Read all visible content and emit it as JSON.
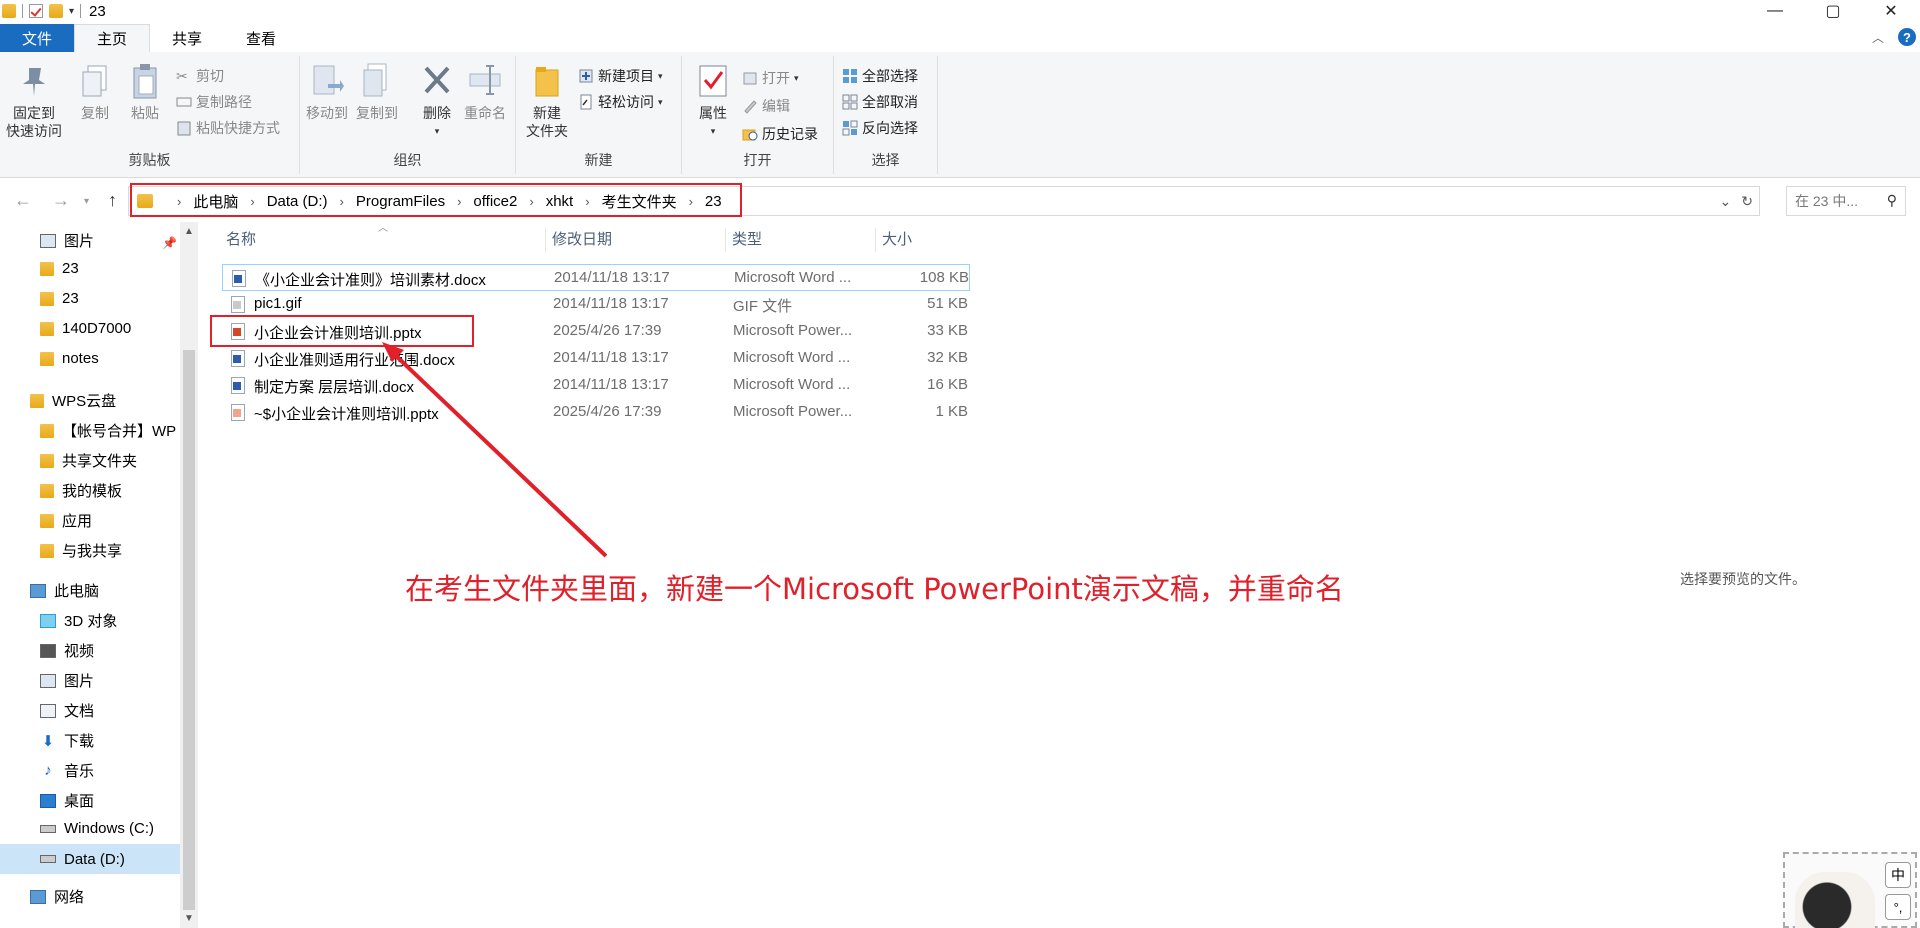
{
  "window": {
    "title": "23",
    "controls": [
      "—",
      "▢",
      "✕"
    ]
  },
  "tabs": [
    {
      "label": "文件"
    },
    {
      "label": "主页"
    },
    {
      "label": "共享"
    },
    {
      "label": "查看"
    }
  ],
  "ribbon": {
    "clipboard": {
      "label": "剪贴板",
      "pin": "固定到\n快速访问",
      "pin_line1": "固定到",
      "pin_line2": "快速访问",
      "copy": "复制",
      "paste": "粘贴",
      "cut": "剪切",
      "copy_path": "复制路径",
      "paste_shortcut": "粘贴快捷方式"
    },
    "organize": {
      "label": "组织",
      "move_to": "移动到",
      "copy_to": "复制到",
      "delete": "删除",
      "rename": "重命名"
    },
    "new": {
      "label": "新建",
      "new_folder_line1": "新建",
      "new_folder_line2": "文件夹",
      "new_item": "新建项目",
      "easy_access": "轻松访问"
    },
    "open": {
      "label": "打开",
      "properties": "属性",
      "open": "打开",
      "edit": "编辑",
      "history": "历史记录"
    },
    "select": {
      "label": "选择",
      "select_all": "全部选择",
      "select_none": "全部取消",
      "invert": "反向选择"
    }
  },
  "address": {
    "crumbs": [
      "此电脑",
      "Data (D:)",
      "ProgramFiles",
      "office2",
      "xhkt",
      "考生文件夹",
      "23"
    ],
    "search_placeholder": "在 23 中..."
  },
  "sidebar": {
    "items": [
      {
        "label": "图片",
        "type": "pictures"
      },
      {
        "label": "23",
        "type": "folder"
      },
      {
        "label": "23",
        "type": "folder"
      },
      {
        "label": "140D7000",
        "type": "folder"
      },
      {
        "label": "notes",
        "type": "folder"
      },
      {
        "label": "WPS云盘",
        "type": "cloud"
      },
      {
        "label": "【帐号合并】WP",
        "type": "folder"
      },
      {
        "label": "共享文件夹",
        "type": "shared"
      },
      {
        "label": "我的模板",
        "type": "folder"
      },
      {
        "label": "应用",
        "type": "folder"
      },
      {
        "label": "与我共享",
        "type": "folder"
      },
      {
        "label": "此电脑",
        "type": "pc"
      },
      {
        "label": "3D 对象",
        "type": "3d"
      },
      {
        "label": "视频",
        "type": "video"
      },
      {
        "label": "图片",
        "type": "pictures"
      },
      {
        "label": "文档",
        "type": "docs"
      },
      {
        "label": "下载",
        "type": "download"
      },
      {
        "label": "音乐",
        "type": "music"
      },
      {
        "label": "桌面",
        "type": "desktop"
      },
      {
        "label": "Windows (C:)",
        "type": "drive"
      },
      {
        "label": "Data (D:)",
        "type": "drive"
      },
      {
        "label": "网络",
        "type": "network"
      }
    ]
  },
  "file_list": {
    "headers": {
      "name": "名称",
      "date": "修改日期",
      "type": "类型",
      "size": "大小"
    },
    "rows": [
      {
        "name": "《小企业会计准则》培训素材.docx",
        "date": "2014/11/18 13:17",
        "type": "Microsoft Word ...",
        "size": "108 KB",
        "icon": "word"
      },
      {
        "name": "pic1.gif",
        "date": "2014/11/18 13:17",
        "type": "GIF 文件",
        "size": "51 KB",
        "icon": "gif"
      },
      {
        "name": "小企业会计准则培训.pptx",
        "date": "2025/4/26 17:39",
        "type": "Microsoft Power...",
        "size": "33 KB",
        "icon": "ppt"
      },
      {
        "name": "小企业准则适用行业范围.docx",
        "date": "2014/11/18 13:17",
        "type": "Microsoft Word ...",
        "size": "32 KB",
        "icon": "word"
      },
      {
        "name": "制定方案 层层培训.docx",
        "date": "2014/11/18 13:17",
        "type": "Microsoft Word ...",
        "size": "16 KB",
        "icon": "word"
      },
      {
        "name": "~$小企业会计准则培训.pptx",
        "date": "2025/4/26 17:39",
        "type": "Microsoft Power...",
        "size": "1 KB",
        "icon": "pptfaint"
      }
    ]
  },
  "annotation": "在考生文件夹里面，新建一个Microsoft PowerPoint演示文稿，并重命名",
  "preview_hint": "选择要预览的文件。",
  "ime": {
    "mode": "中",
    "punct": "°,"
  },
  "colors": {
    "accent": "#1a6cc1",
    "annotation": "#e0202a",
    "selection": "#cce4f7"
  }
}
